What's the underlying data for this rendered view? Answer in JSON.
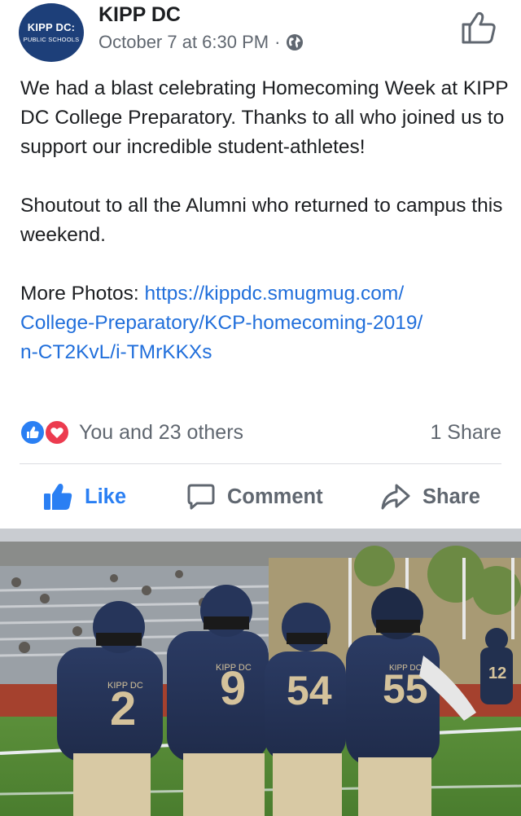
{
  "post": {
    "page_name": "KIPP DC",
    "avatar_text_1": "KIPP DC:",
    "avatar_text_2": "PUBLIC SCHOOLS",
    "timestamp": "October 7 at 6:30 PM",
    "separator_dot": "·",
    "privacy_icon": "globe-icon",
    "text_paragraph_1": "We had a blast celebrating Homecoming Week at KIPP DC College Preparatory. Thanks to all who joined us to support our incredible student-athletes!",
    "text_paragraph_2": "Shoutout to all the Alumni who returned to campus this weekend.",
    "more_photos_label": "More Photos: ",
    "more_photos_link_line_1": "https://kippdc.smugmug.com/",
    "more_photos_link_line_2": "College-Preparatory/KCP-homecoming-2019/",
    "more_photos_link_line_3": "n-CT2KvL/i-TMrKKXs"
  },
  "reactions": {
    "icons": [
      "like-reaction-icon",
      "love-reaction-icon"
    ],
    "count_text": "You and 23 others",
    "shares_text": "1 Share"
  },
  "actions": {
    "like_label": "Like",
    "comment_label": "Comment",
    "share_label": "Share"
  },
  "photo": {
    "jersey_numbers": [
      "2",
      "9",
      "54",
      "55",
      "12"
    ],
    "jersey_text": "KIPP DC"
  },
  "colors": {
    "link": "#216fdb",
    "like_active": "#2a7ff3",
    "love": "#ec3b4f",
    "secondary_text": "#606770",
    "avatar_bg": "#1d3f79"
  }
}
